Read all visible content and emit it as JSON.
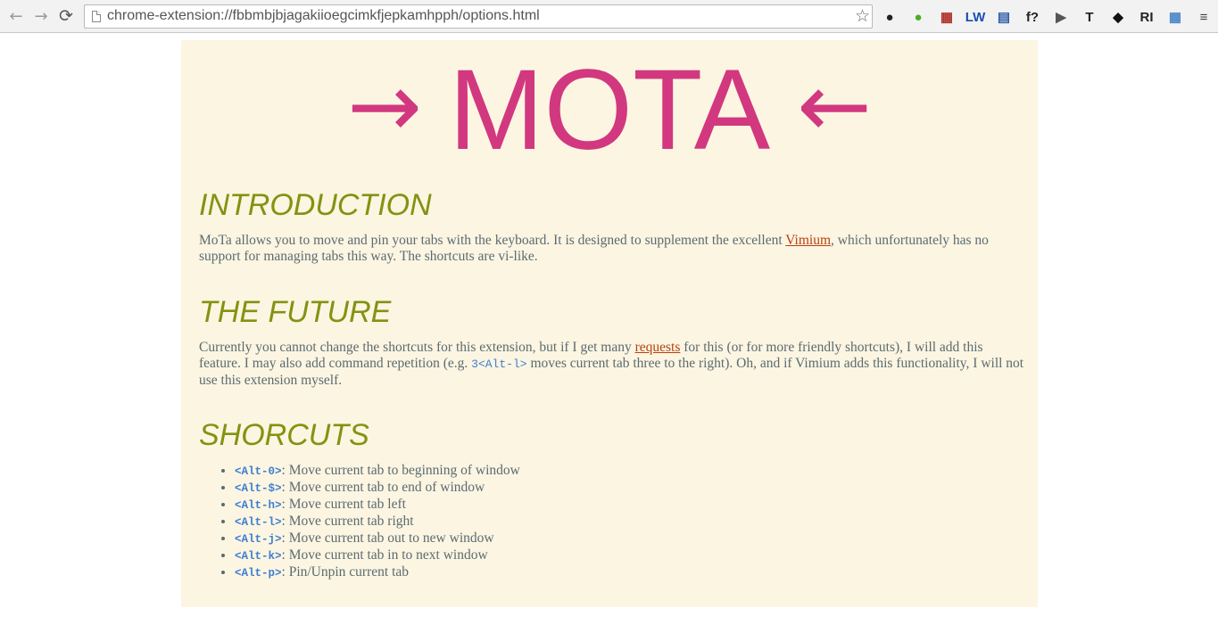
{
  "browser": {
    "back_icon": "←",
    "forward_icon": "→",
    "reload_icon": "⟳",
    "url": "chrome-extension://fbbmbjbjagakiioegcimkfjepkamhpph/options.html",
    "star_icon": "☆",
    "extensions": [
      {
        "name": "colorpicker-icon",
        "glyph": "●",
        "color": "#222222"
      },
      {
        "name": "green-ball-icon",
        "glyph": "●",
        "color": "#4cae1d"
      },
      {
        "name": "grid-badge-icon",
        "glyph": "▦",
        "color": "#b0302a"
      },
      {
        "name": "lw-icon",
        "glyph": "LW",
        "color": "#1b4fb0"
      },
      {
        "name": "calculator-icon",
        "glyph": "▤",
        "color": "#2a5aa8"
      },
      {
        "name": "font-question-icon",
        "glyph": "f?",
        "color": "#222222"
      },
      {
        "name": "play-icon",
        "glyph": "▶",
        "color": "#555555"
      },
      {
        "name": "t-icon",
        "glyph": "T",
        "color": "#222222"
      },
      {
        "name": "cat-icon",
        "glyph": "◆",
        "color": "#111111"
      },
      {
        "name": "ri-icon",
        "glyph": "RI",
        "color": "#222222"
      },
      {
        "name": "window-grid-icon",
        "glyph": "▦",
        "color": "#4a86c8"
      },
      {
        "name": "menu-icon",
        "glyph": "≡",
        "color": "#444444"
      }
    ]
  },
  "page": {
    "logo": {
      "left_arrow": "→",
      "word": "MOTA",
      "right_arrow": "←",
      "color": "#d2387f"
    },
    "intro": {
      "heading": "INTRODUCTION",
      "text_before": "MoTa allows you to move and pin your tabs with the keyboard. It is designed to supplement the excellent ",
      "link": "Vimium",
      "text_after": ", which unfortunately has no support for managing tabs this way. The shortcuts are vi-like."
    },
    "future": {
      "heading": "THE FUTURE",
      "text_before": "Currently you cannot change the shortcuts for this extension, but if I get many ",
      "link": "requests",
      "text_mid": " for this (or for more friendly shortcuts), I will add this feature. I may also add command repetition (e.g. ",
      "code": "3<Alt-l>",
      "text_after": " moves current tab three to the right). Oh, and if Vimium adds this functionality, I will not use this extension myself."
    },
    "shortcuts": {
      "heading": "SHORCUTS",
      "items": [
        {
          "key": "<Alt-0>",
          "desc": ": Move current tab to beginning of window"
        },
        {
          "key": "<Alt-$>",
          "desc": ": Move current tab to end of window"
        },
        {
          "key": "<Alt-h>",
          "desc": ": Move current tab left"
        },
        {
          "key": "<Alt-l>",
          "desc": ": Move current tab right"
        },
        {
          "key": "<Alt-j>",
          "desc": ": Move current tab out to new window"
        },
        {
          "key": "<Alt-k>",
          "desc": ": Move current tab in to next window"
        },
        {
          "key": "<Alt-p>",
          "desc": ": Pin/Unpin current tab"
        }
      ]
    }
  }
}
